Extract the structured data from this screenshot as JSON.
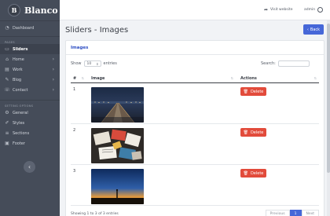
{
  "brand": {
    "badge": "B",
    "name": "Blanco"
  },
  "sidebar": {
    "top_items": [
      {
        "label": "Dashboard",
        "icon": "dashboard-icon"
      }
    ],
    "section_pages": "PAGES",
    "pages": [
      {
        "label": "Sliders",
        "icon": "sliders-icon",
        "active": true
      },
      {
        "label": "Home",
        "icon": "home-icon"
      },
      {
        "label": "Work",
        "icon": "work-icon"
      },
      {
        "label": "Blog",
        "icon": "blog-icon"
      },
      {
        "label": "Contact",
        "icon": "contact-icon"
      }
    ],
    "section_settings": "SETTING OPTIONS",
    "settings": [
      {
        "label": "General",
        "icon": "gear-icon"
      },
      {
        "label": "Styles",
        "icon": "brush-icon"
      },
      {
        "label": "Sections",
        "icon": "sections-icon"
      },
      {
        "label": "Footer",
        "icon": "footer-icon"
      }
    ]
  },
  "topbar": {
    "visit_label": "Visit website",
    "user_label": "admin"
  },
  "page": {
    "title": "Sliders - Images",
    "back_label": "Back"
  },
  "card": {
    "title": "Images",
    "show_label": "Show",
    "entries_value": "10",
    "entries_label": "entries",
    "search_label": "Search:"
  },
  "table": {
    "headers": [
      "#",
      "Image",
      "Actions"
    ],
    "rows": [
      {
        "num": "1",
        "image": "bridge-night-photo",
        "action": "Delete"
      },
      {
        "num": "2",
        "image": "desk-papers-photo",
        "action": "Delete"
      },
      {
        "num": "3",
        "image": "sunset-silhouette-photo",
        "action": "Delete"
      }
    ]
  },
  "footer": {
    "info": "Showing 1 to 3 of 3 entries",
    "prev": "Previous",
    "page": "1",
    "next": "Next"
  },
  "colors": {
    "sidebar_bg": "#454c59",
    "accent": "#4667d8",
    "danger": "#e24b3b"
  }
}
